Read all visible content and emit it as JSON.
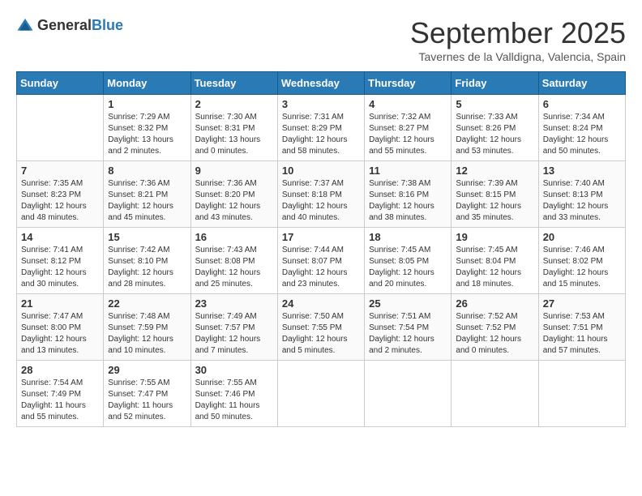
{
  "header": {
    "logo_general": "General",
    "logo_blue": "Blue",
    "month": "September 2025",
    "location": "Tavernes de la Valldigna, Valencia, Spain"
  },
  "days_of_week": [
    "Sunday",
    "Monday",
    "Tuesday",
    "Wednesday",
    "Thursday",
    "Friday",
    "Saturday"
  ],
  "weeks": [
    [
      {
        "day": "",
        "sunrise": "",
        "sunset": "",
        "daylight": ""
      },
      {
        "day": "1",
        "sunrise": "Sunrise: 7:29 AM",
        "sunset": "Sunset: 8:32 PM",
        "daylight": "Daylight: 13 hours and 2 minutes."
      },
      {
        "day": "2",
        "sunrise": "Sunrise: 7:30 AM",
        "sunset": "Sunset: 8:31 PM",
        "daylight": "Daylight: 13 hours and 0 minutes."
      },
      {
        "day": "3",
        "sunrise": "Sunrise: 7:31 AM",
        "sunset": "Sunset: 8:29 PM",
        "daylight": "Daylight: 12 hours and 58 minutes."
      },
      {
        "day": "4",
        "sunrise": "Sunrise: 7:32 AM",
        "sunset": "Sunset: 8:27 PM",
        "daylight": "Daylight: 12 hours and 55 minutes."
      },
      {
        "day": "5",
        "sunrise": "Sunrise: 7:33 AM",
        "sunset": "Sunset: 8:26 PM",
        "daylight": "Daylight: 12 hours and 53 minutes."
      },
      {
        "day": "6",
        "sunrise": "Sunrise: 7:34 AM",
        "sunset": "Sunset: 8:24 PM",
        "daylight": "Daylight: 12 hours and 50 minutes."
      }
    ],
    [
      {
        "day": "7",
        "sunrise": "Sunrise: 7:35 AM",
        "sunset": "Sunset: 8:23 PM",
        "daylight": "Daylight: 12 hours and 48 minutes."
      },
      {
        "day": "8",
        "sunrise": "Sunrise: 7:36 AM",
        "sunset": "Sunset: 8:21 PM",
        "daylight": "Daylight: 12 hours and 45 minutes."
      },
      {
        "day": "9",
        "sunrise": "Sunrise: 7:36 AM",
        "sunset": "Sunset: 8:20 PM",
        "daylight": "Daylight: 12 hours and 43 minutes."
      },
      {
        "day": "10",
        "sunrise": "Sunrise: 7:37 AM",
        "sunset": "Sunset: 8:18 PM",
        "daylight": "Daylight: 12 hours and 40 minutes."
      },
      {
        "day": "11",
        "sunrise": "Sunrise: 7:38 AM",
        "sunset": "Sunset: 8:16 PM",
        "daylight": "Daylight: 12 hours and 38 minutes."
      },
      {
        "day": "12",
        "sunrise": "Sunrise: 7:39 AM",
        "sunset": "Sunset: 8:15 PM",
        "daylight": "Daylight: 12 hours and 35 minutes."
      },
      {
        "day": "13",
        "sunrise": "Sunrise: 7:40 AM",
        "sunset": "Sunset: 8:13 PM",
        "daylight": "Daylight: 12 hours and 33 minutes."
      }
    ],
    [
      {
        "day": "14",
        "sunrise": "Sunrise: 7:41 AM",
        "sunset": "Sunset: 8:12 PM",
        "daylight": "Daylight: 12 hours and 30 minutes."
      },
      {
        "day": "15",
        "sunrise": "Sunrise: 7:42 AM",
        "sunset": "Sunset: 8:10 PM",
        "daylight": "Daylight: 12 hours and 28 minutes."
      },
      {
        "day": "16",
        "sunrise": "Sunrise: 7:43 AM",
        "sunset": "Sunset: 8:08 PM",
        "daylight": "Daylight: 12 hours and 25 minutes."
      },
      {
        "day": "17",
        "sunrise": "Sunrise: 7:44 AM",
        "sunset": "Sunset: 8:07 PM",
        "daylight": "Daylight: 12 hours and 23 minutes."
      },
      {
        "day": "18",
        "sunrise": "Sunrise: 7:45 AM",
        "sunset": "Sunset: 8:05 PM",
        "daylight": "Daylight: 12 hours and 20 minutes."
      },
      {
        "day": "19",
        "sunrise": "Sunrise: 7:45 AM",
        "sunset": "Sunset: 8:04 PM",
        "daylight": "Daylight: 12 hours and 18 minutes."
      },
      {
        "day": "20",
        "sunrise": "Sunrise: 7:46 AM",
        "sunset": "Sunset: 8:02 PM",
        "daylight": "Daylight: 12 hours and 15 minutes."
      }
    ],
    [
      {
        "day": "21",
        "sunrise": "Sunrise: 7:47 AM",
        "sunset": "Sunset: 8:00 PM",
        "daylight": "Daylight: 12 hours and 13 minutes."
      },
      {
        "day": "22",
        "sunrise": "Sunrise: 7:48 AM",
        "sunset": "Sunset: 7:59 PM",
        "daylight": "Daylight: 12 hours and 10 minutes."
      },
      {
        "day": "23",
        "sunrise": "Sunrise: 7:49 AM",
        "sunset": "Sunset: 7:57 PM",
        "daylight": "Daylight: 12 hours and 7 minutes."
      },
      {
        "day": "24",
        "sunrise": "Sunrise: 7:50 AM",
        "sunset": "Sunset: 7:55 PM",
        "daylight": "Daylight: 12 hours and 5 minutes."
      },
      {
        "day": "25",
        "sunrise": "Sunrise: 7:51 AM",
        "sunset": "Sunset: 7:54 PM",
        "daylight": "Daylight: 12 hours and 2 minutes."
      },
      {
        "day": "26",
        "sunrise": "Sunrise: 7:52 AM",
        "sunset": "Sunset: 7:52 PM",
        "daylight": "Daylight: 12 hours and 0 minutes."
      },
      {
        "day": "27",
        "sunrise": "Sunrise: 7:53 AM",
        "sunset": "Sunset: 7:51 PM",
        "daylight": "Daylight: 11 hours and 57 minutes."
      }
    ],
    [
      {
        "day": "28",
        "sunrise": "Sunrise: 7:54 AM",
        "sunset": "Sunset: 7:49 PM",
        "daylight": "Daylight: 11 hours and 55 minutes."
      },
      {
        "day": "29",
        "sunrise": "Sunrise: 7:55 AM",
        "sunset": "Sunset: 7:47 PM",
        "daylight": "Daylight: 11 hours and 52 minutes."
      },
      {
        "day": "30",
        "sunrise": "Sunrise: 7:55 AM",
        "sunset": "Sunset: 7:46 PM",
        "daylight": "Daylight: 11 hours and 50 minutes."
      },
      {
        "day": "",
        "sunrise": "",
        "sunset": "",
        "daylight": ""
      },
      {
        "day": "",
        "sunrise": "",
        "sunset": "",
        "daylight": ""
      },
      {
        "day": "",
        "sunrise": "",
        "sunset": "",
        "daylight": ""
      },
      {
        "day": "",
        "sunrise": "",
        "sunset": "",
        "daylight": ""
      }
    ]
  ]
}
